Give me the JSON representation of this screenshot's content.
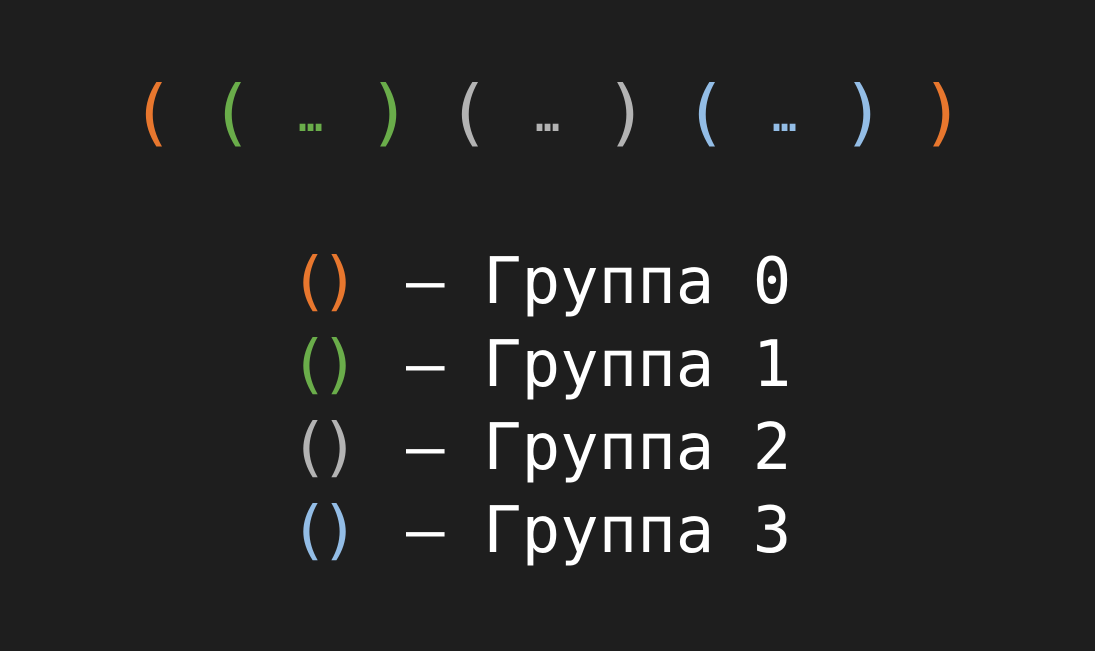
{
  "colors": {
    "background": "#1e1e1e",
    "group0": "#e8772e",
    "group1": "#6aad4a",
    "group2": "#b3b3b3",
    "group3": "#93bde6",
    "text": "#ffffff"
  },
  "pattern": {
    "tokens": [
      {
        "text": "(",
        "kind": "paren",
        "group": "group0"
      },
      {
        "text": "(",
        "kind": "paren",
        "group": "group1"
      },
      {
        "text": "…",
        "kind": "ellipsis",
        "group": "group1"
      },
      {
        "text": ")",
        "kind": "paren",
        "group": "group1"
      },
      {
        "text": "(",
        "kind": "paren",
        "group": "group2"
      },
      {
        "text": "…",
        "kind": "ellipsis",
        "group": "group2"
      },
      {
        "text": ")",
        "kind": "paren",
        "group": "group2"
      },
      {
        "text": "(",
        "kind": "paren",
        "group": "group3"
      },
      {
        "text": "…",
        "kind": "ellipsis",
        "group": "group3"
      },
      {
        "text": ")",
        "kind": "paren",
        "group": "group3"
      },
      {
        "text": ")",
        "kind": "paren",
        "group": "group0"
      }
    ]
  },
  "legend": {
    "items": [
      {
        "parens": "()",
        "label": "– Группа 0",
        "group": "group0"
      },
      {
        "parens": "()",
        "label": "– Группа 1",
        "group": "group1"
      },
      {
        "parens": "()",
        "label": "– Группа 2",
        "group": "group2"
      },
      {
        "parens": "()",
        "label": "– Группа 3",
        "group": "group3"
      }
    ]
  }
}
